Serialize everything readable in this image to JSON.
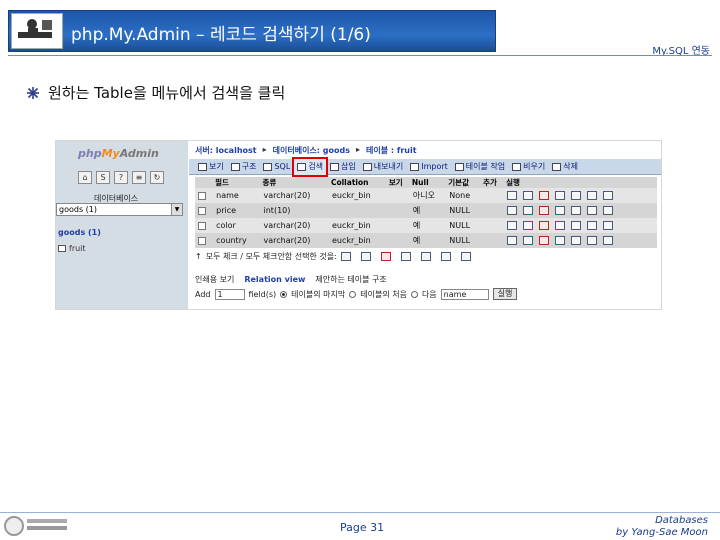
{
  "header": {
    "title": "php.My.Admin – 레코드 검색하기 (1/6)",
    "subject_tag": "My.SQL 연동"
  },
  "bullet": {
    "icon": "snowflake-bullet-icon",
    "text": "원하는 Table을 메뉴에서 검색을 클릭"
  },
  "pma": {
    "logo_php": "php",
    "logo_my": "My",
    "logo_admin": "Admin",
    "left_icons": [
      "home-icon",
      "sql-icon",
      "query-icon",
      "docs-icon",
      "reload-icon"
    ],
    "db_label": "데이터베이스",
    "db_select_value": "goods (1)",
    "db_link": "goods (1)",
    "table_link": "fruit",
    "breadcrumb": {
      "server": "서버: localhost",
      "database": "데이터베이스: goods",
      "table": "테이블 : fruit"
    },
    "tabs": [
      {
        "label": "보기",
        "icon": "browse-icon"
      },
      {
        "label": "구조",
        "icon": "structure-icon"
      },
      {
        "label": "SQL",
        "icon": "sql-icon"
      },
      {
        "label": "검색",
        "icon": "search-icon"
      },
      {
        "label": "삽입",
        "icon": "insert-icon"
      },
      {
        "label": "내보내기",
        "icon": "export-icon"
      },
      {
        "label": "Import",
        "icon": "import-icon"
      },
      {
        "label": "테이블 작업",
        "icon": "operations-icon"
      },
      {
        "label": "비우기",
        "icon": "empty-icon"
      },
      {
        "label": "삭제",
        "icon": "drop-icon"
      }
    ],
    "columns": [
      "필드",
      "종류",
      "Collation",
      "보기",
      "Null",
      "기본값",
      "추가",
      "실행"
    ],
    "rows": [
      {
        "name": "name",
        "type": "varchar(20)",
        "collation": "euckr_bin",
        "attr": "",
        "null": "아니오",
        "default": "None",
        "extra": ""
      },
      {
        "name": "price",
        "type": "int(10)",
        "collation": "",
        "attr": "",
        "null": "예",
        "default": "NULL",
        "extra": ""
      },
      {
        "name": "color",
        "type": "varchar(20)",
        "collation": "euckr_bin",
        "attr": "",
        "null": "예",
        "default": "NULL",
        "extra": ""
      },
      {
        "name": "country",
        "type": "varchar(20)",
        "collation": "euckr_bin",
        "attr": "",
        "null": "예",
        "default": "NULL",
        "extra": ""
      }
    ],
    "selection_row": "모두 체크 / 모두 체크안함 선택한 것을:",
    "print_view": "인쇄용 보기",
    "relation_view": "Relation view",
    "propose_structure": "제안하는 테이블 구조",
    "add_label": "Add",
    "add_count": "1",
    "fields_label": "field(s)",
    "at_end": "테이블의 마지막",
    "at_begin": "테이블의 처음",
    "after_label": "다음",
    "after_value": "name",
    "go_button": "실행"
  },
  "footer": {
    "school_seal": "university-seal-icon",
    "page": "Page 31",
    "course": "Databases",
    "author": "by Yang-Sae Moon"
  }
}
